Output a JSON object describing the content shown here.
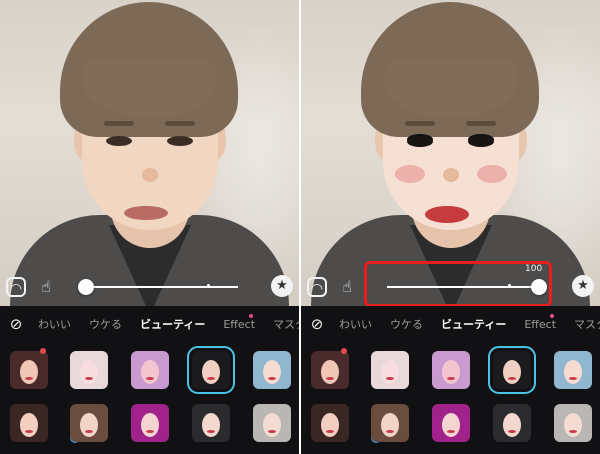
{
  "panels": [
    {
      "id": "before",
      "slider": {
        "value_label": "",
        "level": 0.0
      },
      "highlight": false
    },
    {
      "id": "after",
      "slider": {
        "value_label": "100",
        "level": 1.0
      },
      "highlight": true
    }
  ],
  "tabs": [
    {
      "label": "わいい",
      "active": false
    },
    {
      "label": "ウケる",
      "active": false
    },
    {
      "label": "ビューティー",
      "active": true
    },
    {
      "label": "Effect",
      "active": false
    },
    {
      "label": "マスク",
      "active": false
    }
  ],
  "icons": {
    "compare": "face-compare-icon",
    "hand": "hand-touch-icon",
    "favorite": "star-icon",
    "none": "no-filter-icon"
  },
  "colors": {
    "highlight": "#e81f1f",
    "selected": "#48c3e6",
    "accent_dot": "#e64a8e"
  },
  "filters": [
    {
      "palette": [
        "#4a2a2a",
        "#f0c6b5"
      ]
    },
    {
      "palette": [
        "#e8d8da",
        "#f7dde0"
      ]
    },
    {
      "palette": [
        "#c89ad0",
        "#f3c6cf"
      ]
    },
    {
      "palette": [
        "#1b1b1d",
        "#efd0c3"
      ]
    },
    {
      "palette": [
        "#8fb7cf",
        "#f5dbd2"
      ]
    },
    {
      "palette": [
        "#3a2622",
        "#f2cfc1"
      ]
    },
    {
      "palette": [
        "#6a4d3e",
        "#f3d5c7"
      ]
    },
    {
      "palette": [
        "#a0228a",
        "#f3d4d0"
      ]
    },
    {
      "palette": [
        "#2b2b2d",
        "#f2d8cf"
      ]
    },
    {
      "palette": [
        "#b9b6b3",
        "#f4dcd3"
      ]
    }
  ]
}
